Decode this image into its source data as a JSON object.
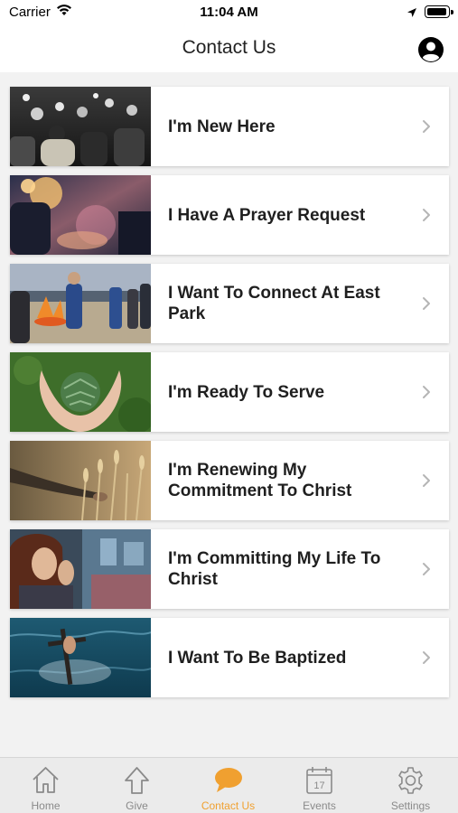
{
  "status": {
    "carrier": "Carrier",
    "time": "11:04 AM"
  },
  "nav": {
    "title": "Contact Us",
    "profile_icon": "person-circle-icon"
  },
  "items": [
    {
      "label": "I'm New Here",
      "image": "crowd-worship-photo"
    },
    {
      "label": "I Have A Prayer Request",
      "image": "candle-prayer-photo"
    },
    {
      "label": "I Want To Connect At East Park",
      "image": "beach-bonfire-photo"
    },
    {
      "label": "I'm Ready To Serve",
      "image": "hands-holding-plant-photo"
    },
    {
      "label": "I'm Renewing My Commitment To Christ",
      "image": "hand-wheat-field-photo"
    },
    {
      "label": "I'm Committing My Life To Christ",
      "image": "woman-praying-photo"
    },
    {
      "label": "I Want To Be Baptized",
      "image": "cross-in-water-photo"
    }
  ],
  "tabs": [
    {
      "label": "Home",
      "icon": "home-icon",
      "active": false
    },
    {
      "label": "Give",
      "icon": "arrow-up-icon",
      "active": false
    },
    {
      "label": "Contact Us",
      "icon": "speech-bubble-icon",
      "active": true
    },
    {
      "label": "Events",
      "icon": "calendar-icon",
      "active": false,
      "badge": "17"
    },
    {
      "label": "Settings",
      "icon": "gear-icon",
      "active": false
    }
  ],
  "colors": {
    "accent": "#f0a030",
    "tab_inactive": "#8a8a8a",
    "background": "#f2f2f2"
  }
}
